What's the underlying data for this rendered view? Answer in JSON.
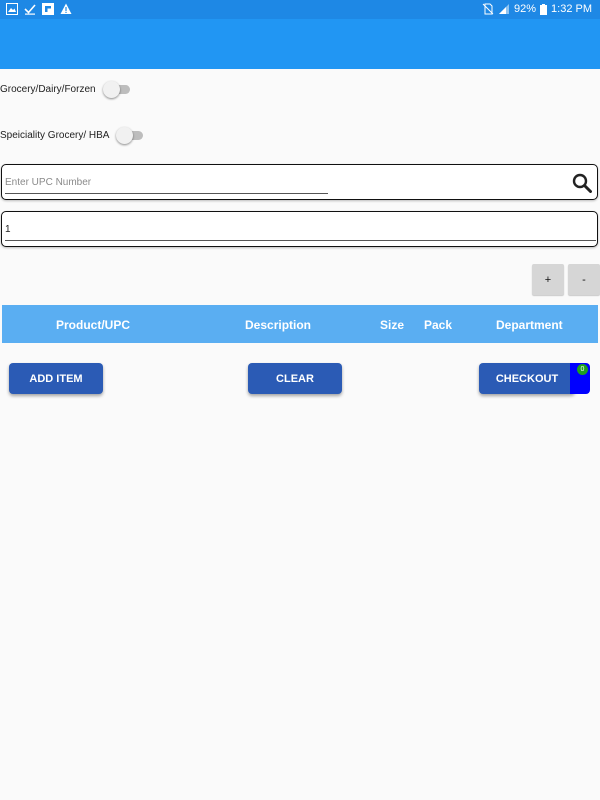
{
  "status_bar": {
    "left_icons": [
      "image-icon",
      "checkmark-icon",
      "flipboard-icon",
      "warning-icon"
    ],
    "right_icons": [
      "no-sim-icon",
      "signal-icon"
    ],
    "battery": "92%",
    "time": "1:32 PM"
  },
  "toggles": [
    {
      "label": "Grocery/Dairy/Forzen",
      "on": false
    },
    {
      "label": "Speiciality Grocery/ HBA",
      "on": false
    }
  ],
  "upc_input": {
    "placeholder": "Enter UPC Number",
    "value": ""
  },
  "quantity_input": {
    "value": "1"
  },
  "stepper": {
    "plus_label": "+",
    "minus_label": "-"
  },
  "table": {
    "columns": [
      "Product/UPC",
      "Description",
      "Size",
      "Pack",
      "Department"
    ]
  },
  "actions": {
    "add_item": "ADD ITEM",
    "clear": "CLEAR",
    "checkout": "CHECKOUT",
    "cart_count": "0"
  },
  "colors": {
    "status_bar": "#1e88e5",
    "app_bar": "#2196f3",
    "table_header": "#5aaef2",
    "button": "#2b5bb5",
    "checkout_accent": "#0000ff",
    "badge": "#1ea11e"
  }
}
